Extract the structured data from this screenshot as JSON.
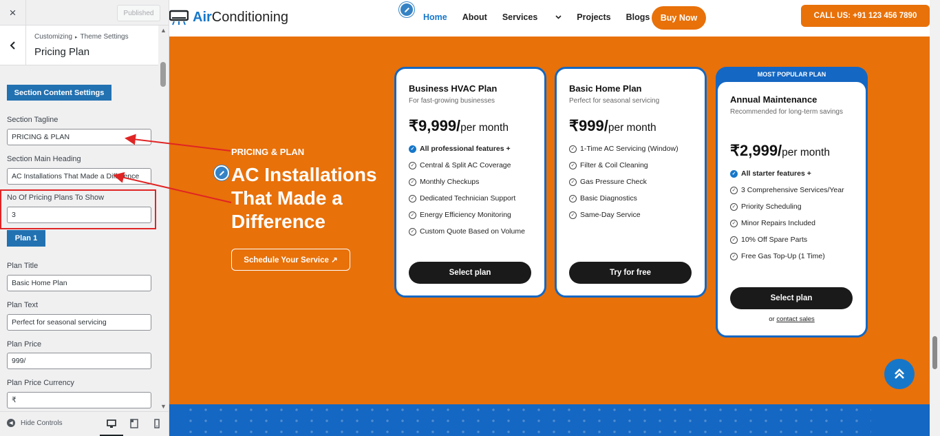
{
  "customizer": {
    "close_icon": "×",
    "publish_label": "Published",
    "breadcrumb": {
      "root": "Customizing",
      "section": "Theme Settings"
    },
    "section_title": "Pricing Plan",
    "section_content_button": "Section Content Settings",
    "fields": {
      "tagline_label": "Section Tagline",
      "tagline_value": "PRICING & PLAN",
      "heading_label": "Section Main Heading",
      "heading_value": "AC Installations That Made a Difference",
      "plans_count_label": "No Of Pricing Plans To Show",
      "plans_count_value": "3",
      "plan_button": "Plan 1",
      "plan_title_label": "Plan Title",
      "plan_title_value": "Basic Home Plan",
      "plan_text_label": "Plan Text",
      "plan_text_value": "Perfect for seasonal servicing",
      "plan_price_label": "Plan Price",
      "plan_price_value": "999/",
      "plan_currency_label": "Plan Price Currency",
      "plan_currency_value": "₹"
    },
    "footer": {
      "hide_controls": "Hide Controls"
    }
  },
  "site": {
    "logo": {
      "brand_a": "Air",
      "brand_b": "Conditioning"
    },
    "nav": {
      "home": "Home",
      "about": "About",
      "services": "Services",
      "projects": "Projects",
      "blogs": "Blogs",
      "buy_now": "Buy Now",
      "call": "CALL US: +91 123 456 7890"
    },
    "hero": {
      "tagline": "PRICING & PLAN",
      "heading": "AC Installations That Made a Difference",
      "cta": "Schedule Your Service ↗"
    },
    "plans": [
      {
        "title": "Business HVAC Plan",
        "subtitle": "For fast-growing businesses",
        "price": "₹9,999/",
        "period": "per month",
        "features": [
          {
            "text": "All professional features +",
            "strong": true
          },
          {
            "text": "Central & Split AC Coverage"
          },
          {
            "text": "Monthly Checkups"
          },
          {
            "text": "Dedicated Technician Support"
          },
          {
            "text": "Energy Efficiency Monitoring"
          },
          {
            "text": "Custom Quote Based on Volume"
          }
        ],
        "button": "Select plan"
      },
      {
        "title": "Basic Home Plan",
        "subtitle": "Perfect for seasonal servicing",
        "price": "₹999/",
        "period": "per month",
        "features": [
          {
            "text": "1-Time AC Servicing (Window)"
          },
          {
            "text": "Filter & Coil Cleaning"
          },
          {
            "text": "Gas Pressure Check"
          },
          {
            "text": "Basic Diagnostics"
          },
          {
            "text": "Same-Day Service"
          }
        ],
        "button": "Try for free"
      },
      {
        "badge": "MOST POPULAR PLAN",
        "title": "Annual Maintenance",
        "subtitle": "Recommended for long-term savings",
        "price": "₹2,999/",
        "period": "per month",
        "features": [
          {
            "text": "All starter features +",
            "strong": true
          },
          {
            "text": "3 Comprehensive Services/Year"
          },
          {
            "text": "Priority Scheduling"
          },
          {
            "text": "Minor Repairs Included"
          },
          {
            "text": "10% Off Spare Parts"
          },
          {
            "text": "Free Gas Top-Up (1 Time)"
          }
        ],
        "button": "Select plan",
        "contact_prefix": "or",
        "contact_link": "contact sales"
      }
    ]
  },
  "colors": {
    "orange": "#e8710a",
    "blue": "#1467c2",
    "wp_blue": "#2271b1",
    "annotation_red": "#e02424"
  }
}
